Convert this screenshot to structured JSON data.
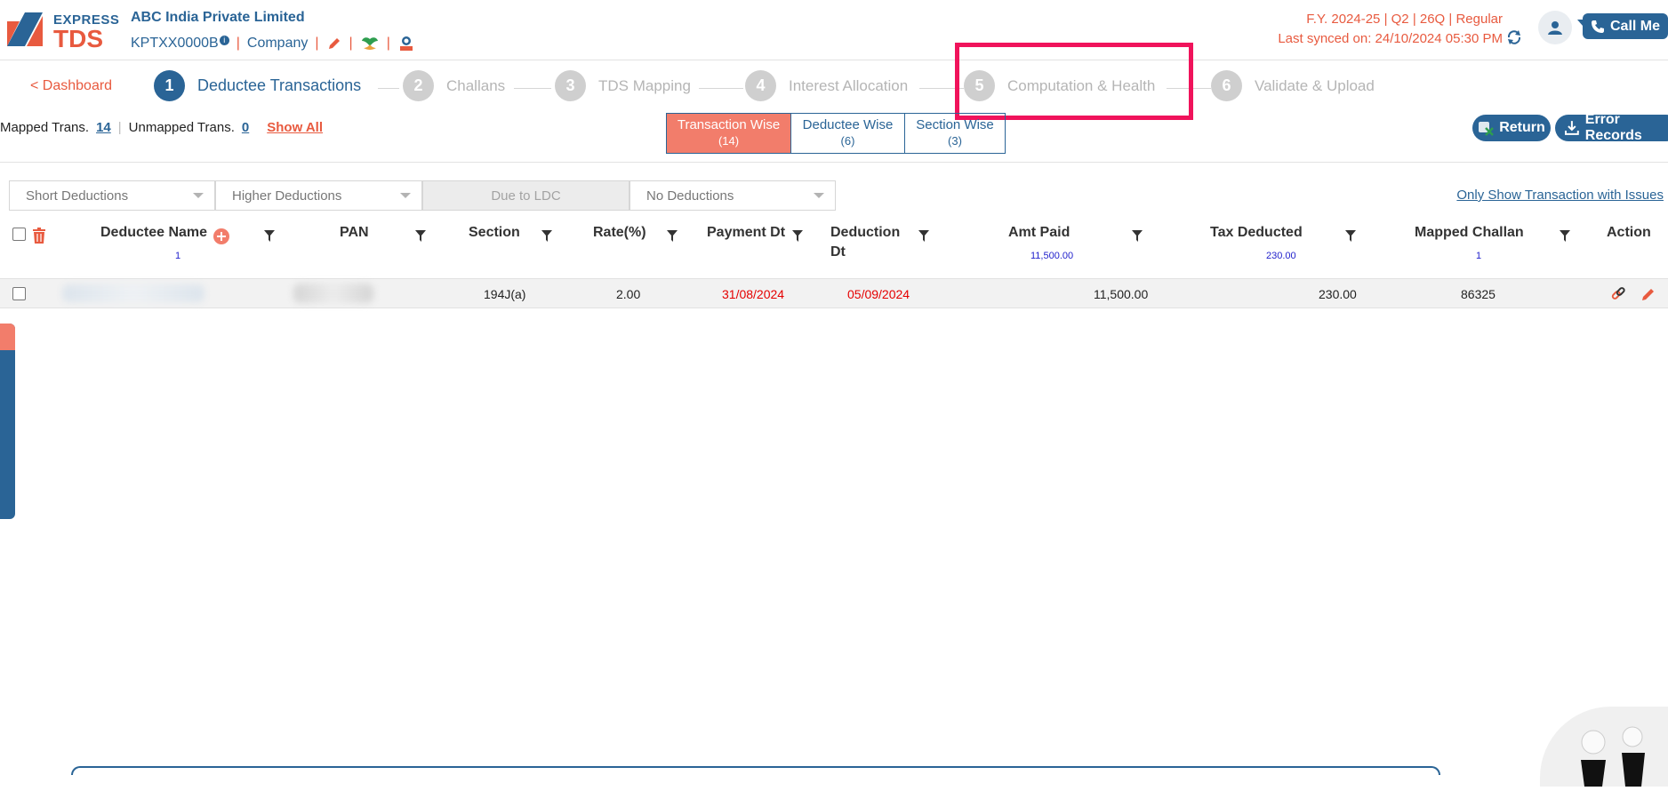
{
  "header": {
    "logo": {
      "top": "EXPRESS",
      "bottom": "TDS"
    },
    "company_name": "ABC India Private Limited",
    "tan": "KPTXX0000B",
    "entity_type": "Company",
    "fy_line": "F.Y. 2024-25  | Q2  | 26Q | Regular",
    "last_synced": "Last synced on: 24/10/2024 05:30 PM",
    "call_button": "Call Me",
    "icons": [
      "edit-icon",
      "dsc-icon",
      "certificate-icon",
      "sync-icon",
      "user-icon"
    ]
  },
  "stepper": {
    "back_link": "< Dashboard",
    "steps": [
      {
        "num": "1",
        "label": "Deductee Transactions",
        "state": "active"
      },
      {
        "num": "2",
        "label": "Challans",
        "state": "inactive"
      },
      {
        "num": "3",
        "label": "TDS Mapping",
        "state": "inactive"
      },
      {
        "num": "4",
        "label": "Interest Allocation",
        "state": "inactive"
      },
      {
        "num": "5",
        "label": "Computation & Health",
        "state": "inactive"
      },
      {
        "num": "6",
        "label": "Validate & Upload",
        "state": "inactive"
      }
    ]
  },
  "counts": {
    "mapped_label": "Mapped Trans.",
    "mapped_value": "14",
    "unmapped_label": "Unmapped Trans.",
    "unmapped_value": "0",
    "show_all": "Show All"
  },
  "view_toggle": [
    {
      "label": "Transaction Wise",
      "count": "(14)",
      "active": true
    },
    {
      "label": "Deductee Wise",
      "count": "(6)",
      "active": false
    },
    {
      "label": "Section Wise",
      "count": "(3)",
      "active": false
    }
  ],
  "actions": {
    "return": "Return",
    "error_records": "Error Records"
  },
  "filters": {
    "short_deductions": "Short Deductions",
    "higher_deductions": "Higher Deductions",
    "due_to_ldc": "Due to LDC",
    "no_deductions": "No Deductions",
    "only_issues": "Only Show Transaction with Issues"
  },
  "table": {
    "headers": {
      "deductee_name": "Deductee Name",
      "pan": "PAN",
      "section": "Section",
      "rate": "Rate(%)",
      "payment_dt": "Payment Dt",
      "deduction_dt_1": "Deduction",
      "deduction_dt_2": "Dt",
      "amt_paid": "Amt Paid",
      "tax_deducted": "Tax Deducted",
      "mapped_challan": "Mapped Challan",
      "action": "Action"
    },
    "subtotals": {
      "deductee_count": "1",
      "amt_paid": "11,500.00",
      "tax_deducted": "230.00",
      "challan_count": "1"
    },
    "rows": [
      {
        "section": "194J(a)",
        "rate": "2.00",
        "payment_dt": "31/08/2024",
        "deduction_dt": "05/09/2024",
        "amt_paid": "11,500.00",
        "tax_deducted": "230.00",
        "mapped_challan": "86325"
      }
    ]
  },
  "colors": {
    "primary": "#2a6496",
    "accent": "#e85a3f",
    "highlight": "#f0135b",
    "toggle_active": "#f27d6b"
  }
}
